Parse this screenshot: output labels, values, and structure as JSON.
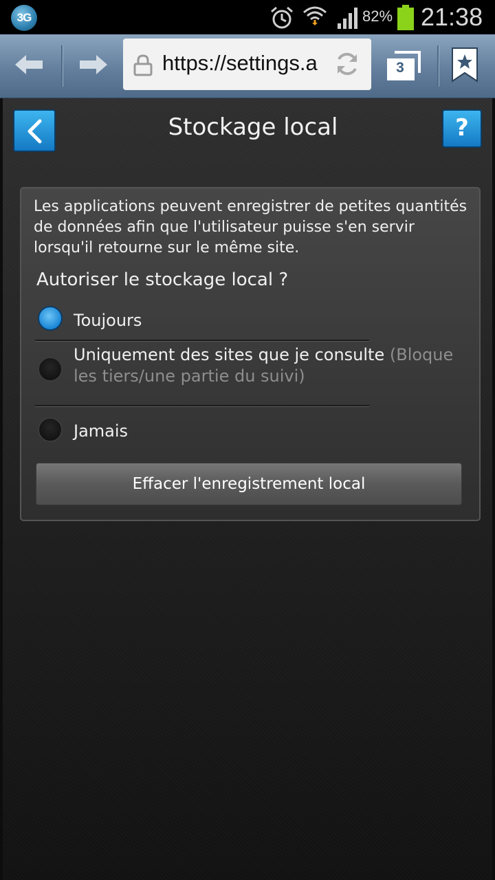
{
  "statusbar": {
    "network_badge": "3G",
    "battery_percent": "82%",
    "time": "21:38",
    "icons": [
      "alarm-icon",
      "wifi-icon",
      "signal-icon",
      "battery-icon"
    ]
  },
  "browser": {
    "url": "https://settings.a",
    "tab_count": "3",
    "icons": [
      "back-arrow-icon",
      "forward-arrow-icon",
      "lock-icon",
      "reload-icon",
      "tabs-icon",
      "bookmark-icon"
    ]
  },
  "page": {
    "title": "Stockage local",
    "help_label": "?",
    "description": "Les applications peuvent enregistrer de petites quantités de données afin que l'utilisateur puisse s'en servir lorsqu'il retourne sur le même site.",
    "question": "Autoriser le stockage local ?",
    "options": [
      {
        "label": "Toujours",
        "note": "",
        "selected": true
      },
      {
        "label": "Uniquement des sites que je consulte",
        "note": "(Bloque les tiers/une partie du suivi)",
        "selected": false
      },
      {
        "label": "Jamais",
        "note": "",
        "selected": false
      }
    ],
    "clear_button": "Effacer l'enregistrement local"
  },
  "colors": {
    "accent_blue": "#1a86d6",
    "toolbar": "#647f9d",
    "battery_green": "#8bd21a"
  }
}
